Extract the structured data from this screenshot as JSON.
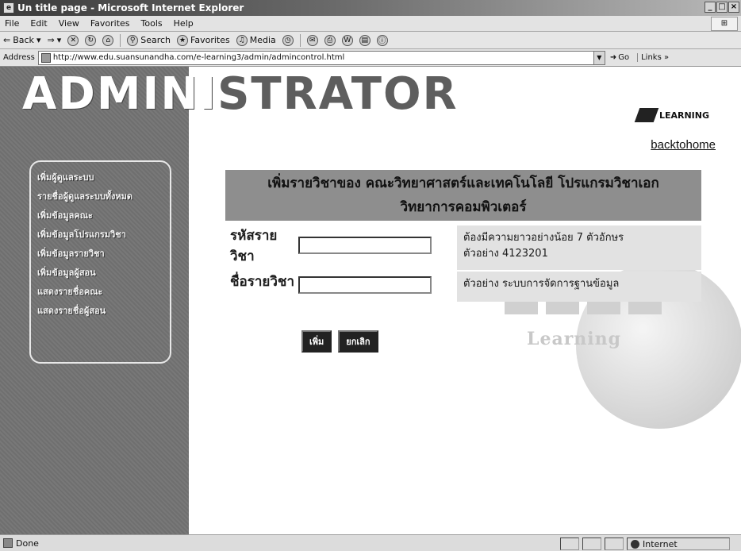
{
  "window": {
    "title": "Un title page - Microsoft Internet Explorer",
    "buttons": {
      "minimize": "_",
      "maximize": "□",
      "close": "×"
    }
  },
  "menubar": [
    "File",
    "Edit",
    "View",
    "Favorites",
    "Tools",
    "Help"
  ],
  "toolbar": {
    "back": "Back",
    "search": "Search",
    "favorites": "Favorites",
    "media": "Media"
  },
  "address": {
    "label": "Address",
    "url": "http://www.edu.suansunandha.com/e-learning3/admin/admincontrol.html",
    "go": "Go",
    "links": "Links »"
  },
  "header": {
    "title_left": "ADMINI",
    "title_right": "STRATOR",
    "logo_text": "LEARNING",
    "back_link": "backtohome"
  },
  "sidebar": {
    "items": [
      "เพิ่มผู้ดูแลระบบ",
      "รายชื่อผู้ดูแลระบบทั้งหมด",
      "เพิ่มข้อมูลคณะ",
      "เพิ่มข้อมูลโปรแกรมวิชา",
      "เพิ่มข้อมูลรายวิชา",
      "เพิ่มข้อมูลผู้สอน",
      "แสดงรายชื่อคณะ",
      "แสดงรายชื่อผู้สอน"
    ]
  },
  "watermark": {
    "text": "Learning"
  },
  "form": {
    "header_line1": "เพิ่มรายวิชาของ คณะวิทยาศาสตร์และเทคโนโลยี โปรแกรมวิชาเอก",
    "header_line2": "วิทยาการคอมพิวเตอร์",
    "code": {
      "label_line1": "รหัสราย",
      "label_line2": "วิชา",
      "value": "",
      "hint_line1": "ต้องมีความยาวอย่างน้อย 7 ตัวอักษร",
      "hint_line2": "ตัวอย่าง 4123201"
    },
    "name": {
      "label": "ชื่อรายวิชา",
      "value": "",
      "hint": "ตัวอย่าง ระบบการจัดการฐานข้อมูล"
    },
    "submit": "เพิ่ม",
    "cancel": "ยกเลิก"
  },
  "status": {
    "text": "Done",
    "zone": "Internet"
  }
}
